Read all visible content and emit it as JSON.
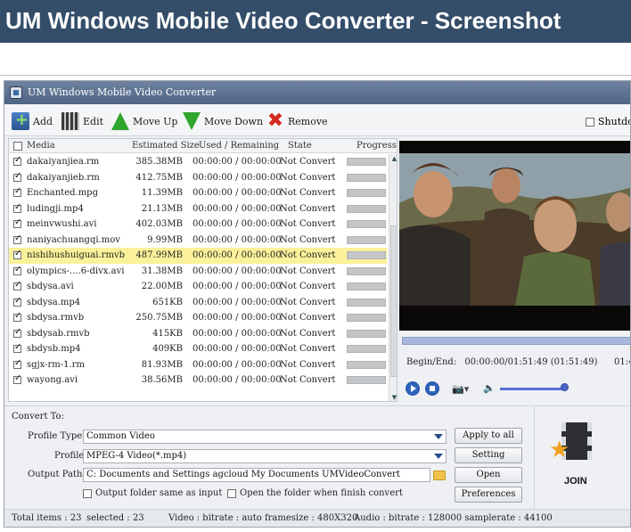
{
  "page": {
    "title": "UM Windows Mobile Video Converter - Screenshot"
  },
  "window": {
    "title": "UM Windows Mobile Video Converter"
  },
  "toolbar": {
    "add_label": "Add",
    "edit_label": "Edit",
    "move_up_label": "Move Up",
    "move_down_label": "Move Down",
    "remove_label": "Remove",
    "shutdown_label": "Shutdo"
  },
  "list": {
    "headers": {
      "media": "Media",
      "size": "Estimated Size",
      "time": "Used / Remaining",
      "state": "State",
      "progress": "Progress"
    },
    "rows": [
      {
        "name": "dakaiyanjiea.rm",
        "size": "385.38MB",
        "time": "00:00:00 / 00:00:00",
        "state": "Not Convert",
        "checked": true,
        "selected": false
      },
      {
        "name": "dakaiyanjieb.rm",
        "size": "412.75MB",
        "time": "00:00:00 / 00:00:00",
        "state": "Not Convert",
        "checked": true,
        "selected": false
      },
      {
        "name": "Enchanted.mpg",
        "size": "11.39MB",
        "time": "00:00:00 / 00:00:00",
        "state": "Not Convert",
        "checked": true,
        "selected": false
      },
      {
        "name": "ludingji.mp4",
        "size": "21.13MB",
        "time": "00:00:00 / 00:00:00",
        "state": "Not Convert",
        "checked": true,
        "selected": false
      },
      {
        "name": "meinvwushi.avi",
        "size": "402.03MB",
        "time": "00:00:00 / 00:00:00",
        "state": "Not Convert",
        "checked": true,
        "selected": false
      },
      {
        "name": "naniyachuangqi.mov",
        "size": "9.99MB",
        "time": "00:00:00 / 00:00:00",
        "state": "Not Convert",
        "checked": true,
        "selected": false
      },
      {
        "name": "nishihushuiguai.rmvb",
        "size": "487.99MB",
        "time": "00:00:00 / 00:00:00",
        "state": "Not Convert",
        "checked": true,
        "selected": true
      },
      {
        "name": "olympics-....6-divx.avi",
        "size": "31.38MB",
        "time": "00:00:00 / 00:00:00",
        "state": "Not Convert",
        "checked": true,
        "selected": false
      },
      {
        "name": "sbdysa.avi",
        "size": "22.00MB",
        "time": "00:00:00 / 00:00:00",
        "state": "Not Convert",
        "checked": true,
        "selected": false
      },
      {
        "name": "sbdysa.mp4",
        "size": "651KB",
        "time": "00:00:00 / 00:00:00",
        "state": "Not Convert",
        "checked": true,
        "selected": false
      },
      {
        "name": "sbdysa.rmvb",
        "size": "250.75MB",
        "time": "00:00:00 / 00:00:00",
        "state": "Not Convert",
        "checked": true,
        "selected": false
      },
      {
        "name": "sbdysab.rmvb",
        "size": "415KB",
        "time": "00:00:00 / 00:00:00",
        "state": "Not Convert",
        "checked": true,
        "selected": false
      },
      {
        "name": "sbdysb.mp4",
        "size": "409KB",
        "time": "00:00:00 / 00:00:00",
        "state": "Not Convert",
        "checked": true,
        "selected": false
      },
      {
        "name": "sgjx-rm-1.rm",
        "size": "81.93MB",
        "time": "00:00:00 / 00:00:00",
        "state": "Not Convert",
        "checked": true,
        "selected": false
      },
      {
        "name": "wayong.avi",
        "size": "38.56MB",
        "time": "00:00:00 / 00:00:00",
        "state": "Not Convert",
        "checked": true,
        "selected": false
      }
    ]
  },
  "player": {
    "begin_end_label": "Begin/End:",
    "begin_end_value": "00:00:00/01:51:49 (01:51:49)",
    "extra_value": "01:4"
  },
  "convert": {
    "heading": "Convert To:",
    "profile_type_label": "Profile Type:",
    "profile_type_value": "Common Video",
    "profile_label": "Profile:",
    "profile_value": "MPEG-4 Video(*.mp4)",
    "output_path_label": "Output Path:",
    "output_path_value": "C: Documents and Settings agcloud My Documents UMVideoConvert",
    "same_as_input_label": "Output folder same as input",
    "open_when_finish_label": "Open the folder when finish convert",
    "apply_all_label": "Apply to all",
    "setting_label": "Setting",
    "open_label": "Open",
    "preferences_label": "Preferences",
    "join_label": "JOIN"
  },
  "status": {
    "total": "Total items : 23",
    "selected": "selected : 23",
    "video": "Video : bitrate : auto framesize : 480X320",
    "audio": "Audio : bitrate : 128000 samplerate : 44100"
  },
  "colors": {
    "banner_bg": "#344d69",
    "titlebar": "#4f6585",
    "selected_row": "#fbf19a",
    "accent_blue": "#2a4d8c"
  }
}
